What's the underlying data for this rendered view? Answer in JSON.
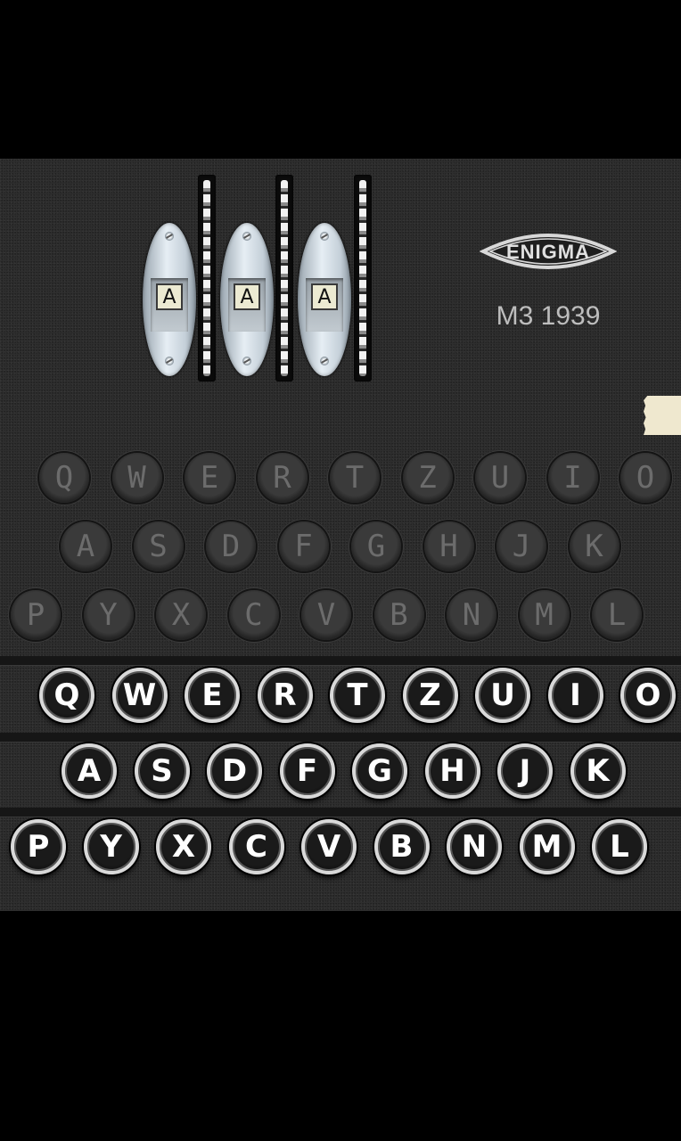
{
  "rotors": [
    "A",
    "A",
    "A"
  ],
  "logo": {
    "text": "ENIGMA"
  },
  "model": "M3 1939",
  "lampboard": {
    "row1": [
      "Q",
      "W",
      "E",
      "R",
      "T",
      "Z",
      "U",
      "I",
      "O"
    ],
    "row2": [
      "A",
      "S",
      "D",
      "F",
      "G",
      "H",
      "J",
      "K"
    ],
    "row3": [
      "P",
      "Y",
      "X",
      "C",
      "V",
      "B",
      "N",
      "M",
      "L"
    ]
  },
  "keyboard": {
    "row1": [
      "Q",
      "W",
      "E",
      "R",
      "T",
      "Z",
      "U",
      "I",
      "O"
    ],
    "row2": [
      "A",
      "S",
      "D",
      "F",
      "G",
      "H",
      "J",
      "K"
    ],
    "row3": [
      "P",
      "Y",
      "X",
      "C",
      "V",
      "B",
      "N",
      "M",
      "L"
    ]
  }
}
